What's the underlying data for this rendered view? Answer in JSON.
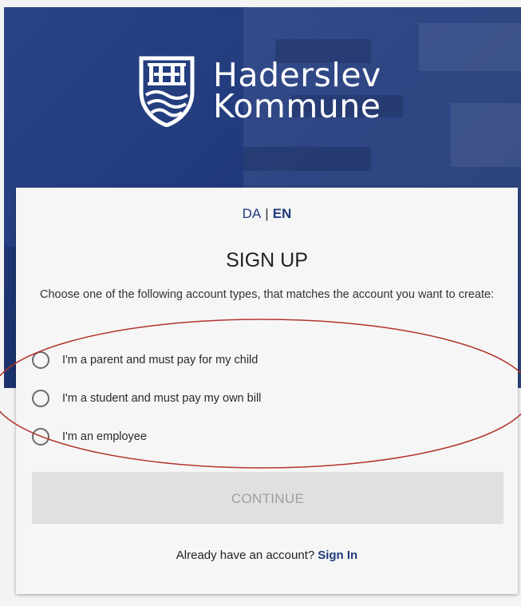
{
  "brand": {
    "name_line1": "Haderslev",
    "name_line2": "Kommune"
  },
  "language": {
    "da": "DA",
    "separator": "|",
    "en": "EN",
    "active": "EN"
  },
  "signup": {
    "title": "SIGN UP",
    "description": "Choose one of the following account types, that matches the account you want to create:",
    "options": [
      {
        "label": "I'm a parent and must pay for my child",
        "selected": false
      },
      {
        "label": "I'm a student and must pay my own bill",
        "selected": false
      },
      {
        "label": "I'm an employee",
        "selected": false
      }
    ],
    "continue_label": "CONTINUE",
    "continue_disabled": true,
    "signin_prompt": "Already have an account?",
    "signin_link": "Sign In"
  },
  "colors": {
    "hero_blue": "#213a7c",
    "link_blue": "#1f3a7a",
    "annotation_red": "#b2352c",
    "button_disabled": "#e0e0e0"
  }
}
